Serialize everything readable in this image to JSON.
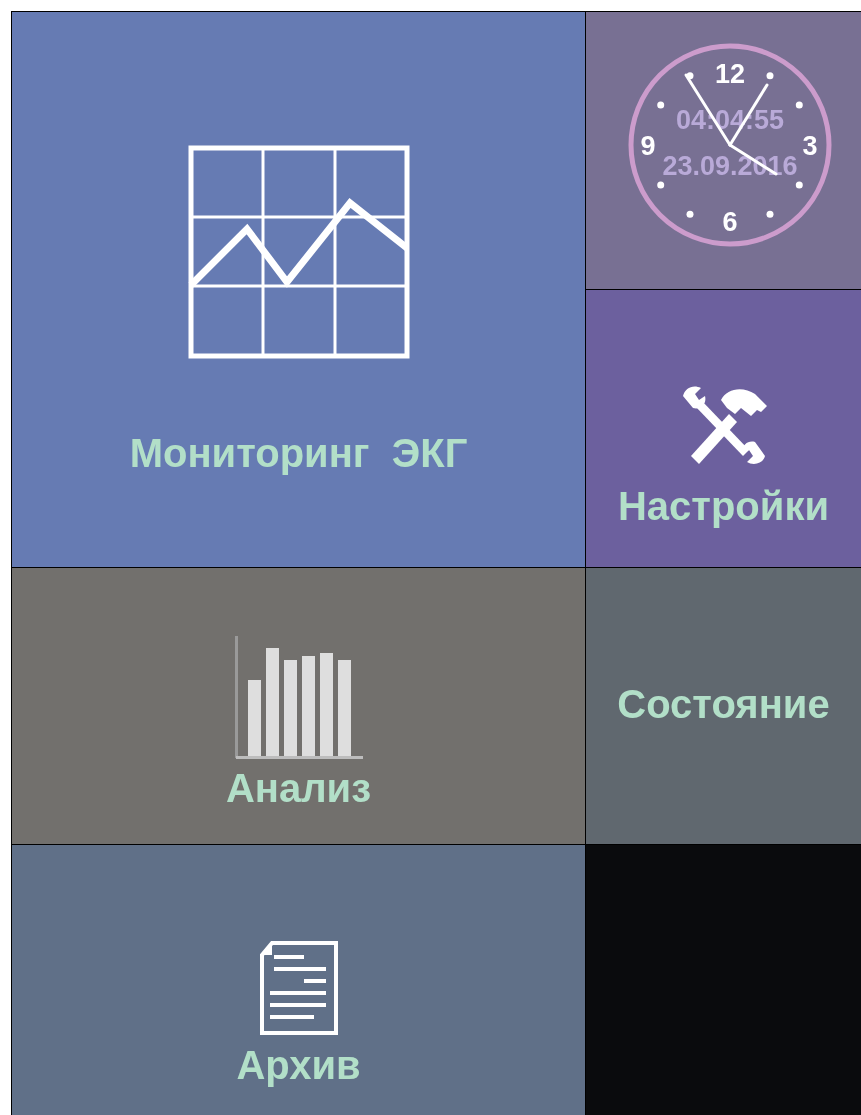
{
  "tiles": [
    {
      "kind": "ecg",
      "label": "Мониторинг  ЭКГ",
      "color": "#667bb3"
    },
    {
      "kind": "clock",
      "numerals": [
        "12",
        "3",
        "6",
        "9"
      ],
      "time": "04:04:55",
      "date": "23.09.2016",
      "color": "#787093"
    },
    {
      "kind": "settings",
      "label": "Настройки",
      "color": "#6c609e"
    },
    {
      "kind": "analysis",
      "label": "Анализ",
      "color": "#72706d"
    },
    {
      "kind": "status",
      "label": "Состояние",
      "color": "#60686f"
    },
    {
      "kind": "archive",
      "label": "Архив",
      "color": "#607088"
    },
    {
      "kind": "empty",
      "color": "#0a0b0d"
    }
  ]
}
